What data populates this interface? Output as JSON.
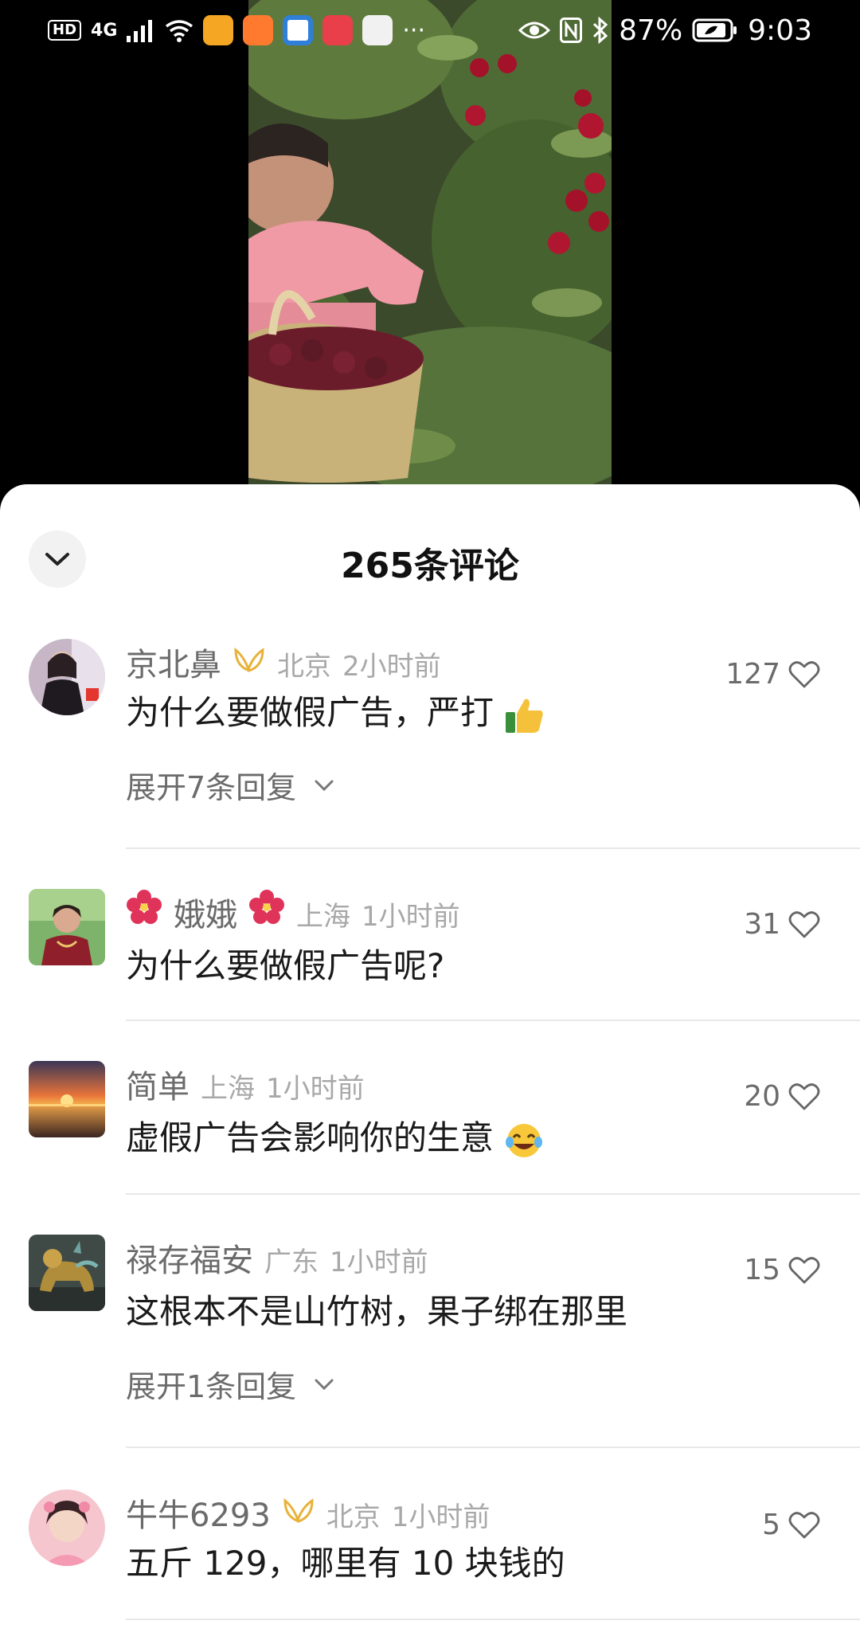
{
  "status_bar": {
    "network": "HD",
    "signal": "4G",
    "battery": "87%",
    "time": "9:03",
    "more": "···"
  },
  "panel": {
    "title": "265条评论"
  },
  "comments": [
    {
      "username": "京北鼻",
      "location": "北京",
      "time": "2小时前",
      "likes": "127",
      "text": "为什么要做假广告，严打",
      "emoji": "thumbs-up",
      "expand": "展开7条回复"
    },
    {
      "username": "娥娥",
      "location": "上海",
      "time": "1小时前",
      "likes": "31",
      "text": "为什么要做假广告呢?"
    },
    {
      "username": "简单",
      "location": "上海",
      "time": "1小时前",
      "likes": "20",
      "text": "虚假广告会影响你的生意",
      "emoji": "laughing-crying"
    },
    {
      "username": "禄存福安",
      "location": "广东",
      "time": "1小时前",
      "likes": "15",
      "text": "这根本不是山竹树，果子绑在那里",
      "expand": "展开1条回复"
    },
    {
      "username": "牛牛6293",
      "location": "北京",
      "time": "1小时前",
      "likes": "5",
      "text": "五斤 129，哪里有 10 块钱的"
    }
  ],
  "colors": {
    "panel_bg": "#ffffff",
    "username": "#6b6b6b",
    "meta": "#a8a8a8",
    "text": "#1a1a1a",
    "badge_gold": "#e8b23a"
  }
}
